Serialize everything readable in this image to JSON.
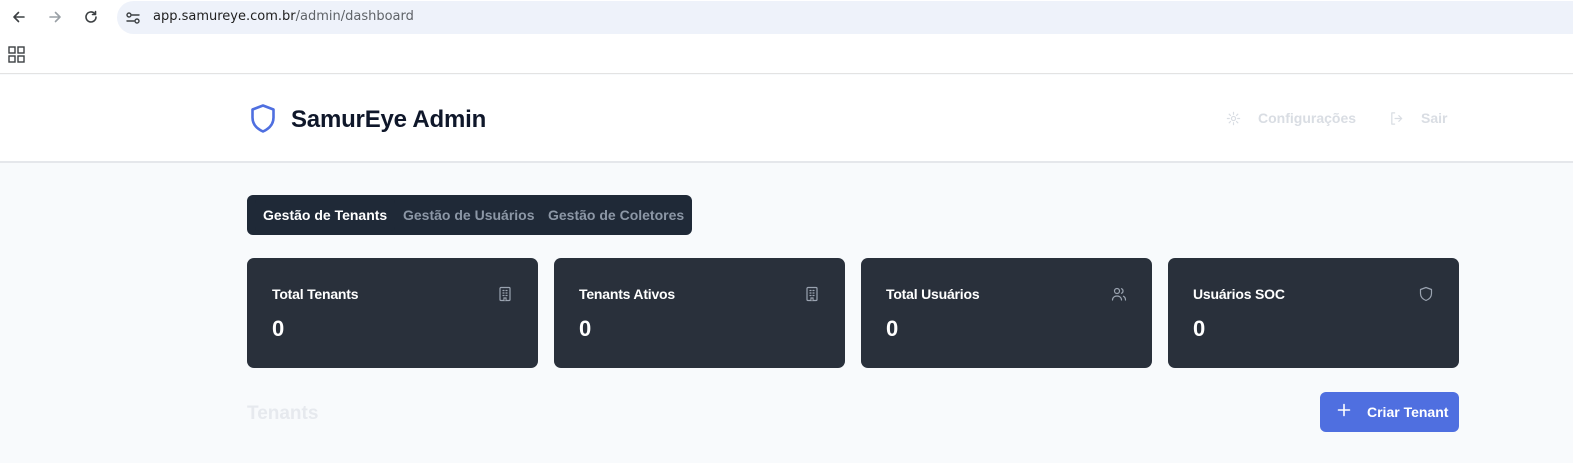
{
  "browser": {
    "url_host": "app.samureye.com.br",
    "url_path": "/admin/dashboard",
    "icons": [
      "back-icon",
      "forward-icon",
      "reload-icon",
      "site-settings-icon",
      "apps-grid-icon"
    ]
  },
  "header": {
    "title": "SamurEye Admin",
    "logo_icon": "shield-icon",
    "settings_label": "Configurações",
    "logout_label": "Sair"
  },
  "tabs": [
    {
      "label": "Gestão de Tenants",
      "active": true
    },
    {
      "label": "Gestão de Usuários",
      "active": false
    },
    {
      "label": "Gestão de Coletores",
      "active": false
    }
  ],
  "stats": [
    {
      "title": "Total Tenants",
      "value": "0",
      "icon": "building-icon"
    },
    {
      "title": "Tenants Ativos",
      "value": "0",
      "icon": "building-icon"
    },
    {
      "title": "Total Usuários",
      "value": "0",
      "icon": "users-icon"
    },
    {
      "title": "Usuários SOC",
      "value": "0",
      "icon": "shield-icon"
    }
  ],
  "section": {
    "title": "Tenants",
    "create_button_label": "Criar Tenant"
  },
  "colors": {
    "accent": "#4f6fe0",
    "card_bg": "#29303b",
    "tabs_bg": "#1f2937",
    "logo": "#4f6fe0"
  }
}
